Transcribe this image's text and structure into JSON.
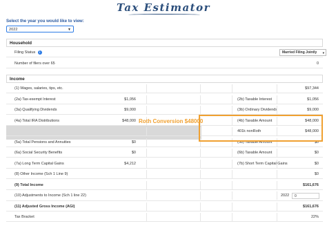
{
  "app": {
    "title": "Tax Estimator"
  },
  "year": {
    "label": "Select the year you would like to view:",
    "selected": "2022"
  },
  "household": {
    "header": "Household",
    "filing_status_label": "Filing Status",
    "filing_status_value": "Married Filing Jointly",
    "filers_over_65_label": "Number of filers over 65",
    "filers_over_65_value": "0"
  },
  "income": {
    "header": "Income",
    "rows": [
      {
        "left_label": "(1) Wages, salaries, tips, etc.",
        "left_val": "",
        "right_label": "",
        "right_val": "$97,344"
      },
      {
        "left_label": "(2a) Tax-exempt Interest",
        "left_val": "$1,056",
        "right_label": "(2b) Taxable Interest",
        "right_val": "$1,056"
      },
      {
        "left_label": "(3a) Qualifying Dividends",
        "left_val": "$9,000",
        "right_label": "(3b) Ordinary Dividends",
        "right_val": "$9,000"
      },
      {
        "left_label": "(4a) Total IRA Distributions",
        "left_val": "$48,000",
        "right_label": "(4b) Taxable Amount",
        "right_val": "$48,000"
      },
      {
        "left_label": "",
        "left_val": "",
        "right_label": "401k nonRoth",
        "right_val": "$48,000"
      },
      {
        "left_label": "(5a) Total Pensions and Annuities",
        "left_val": "$0",
        "right_label": "(5b) Taxable Amount",
        "right_val": "$0"
      },
      {
        "left_label": "(6a) Social Security Benefits",
        "left_val": "$0",
        "right_label": "(6b) Taxable Amount",
        "right_val": "$0"
      },
      {
        "left_label": "(7a) Long Term Capital Gains",
        "left_val": "$4,212",
        "right_label": "(7b) Short Term Capital Gains",
        "right_val": "$0"
      },
      {
        "left_label": "(8) Other Income (Sch 1 Line 9)",
        "left_val": "",
        "right_label": "",
        "right_val": "$0"
      },
      {
        "left_label": "(9) Total Income",
        "left_val": "",
        "right_label": "",
        "right_val": "$161,676"
      },
      {
        "left_label": "(10) Adjustments to Income (Sch 1 line 22)",
        "left_val": "",
        "right_label": "",
        "right_val": ""
      },
      {
        "left_label": "(11) Adjusted Gross Income (AGI)",
        "left_val": "",
        "right_label": "",
        "right_val": "$161,676"
      },
      {
        "left_label": "Tax Bracket",
        "left_val": "",
        "right_label": "",
        "right_val": "22%"
      }
    ],
    "adjustments_year": "2022",
    "adjustments_input": "0"
  },
  "annotation": {
    "roth_conversion": "Roth Conversion $48000"
  },
  "colors": {
    "accent": "#2c7be5",
    "highlight": "#f0a030",
    "title": "#2c4f7c"
  }
}
